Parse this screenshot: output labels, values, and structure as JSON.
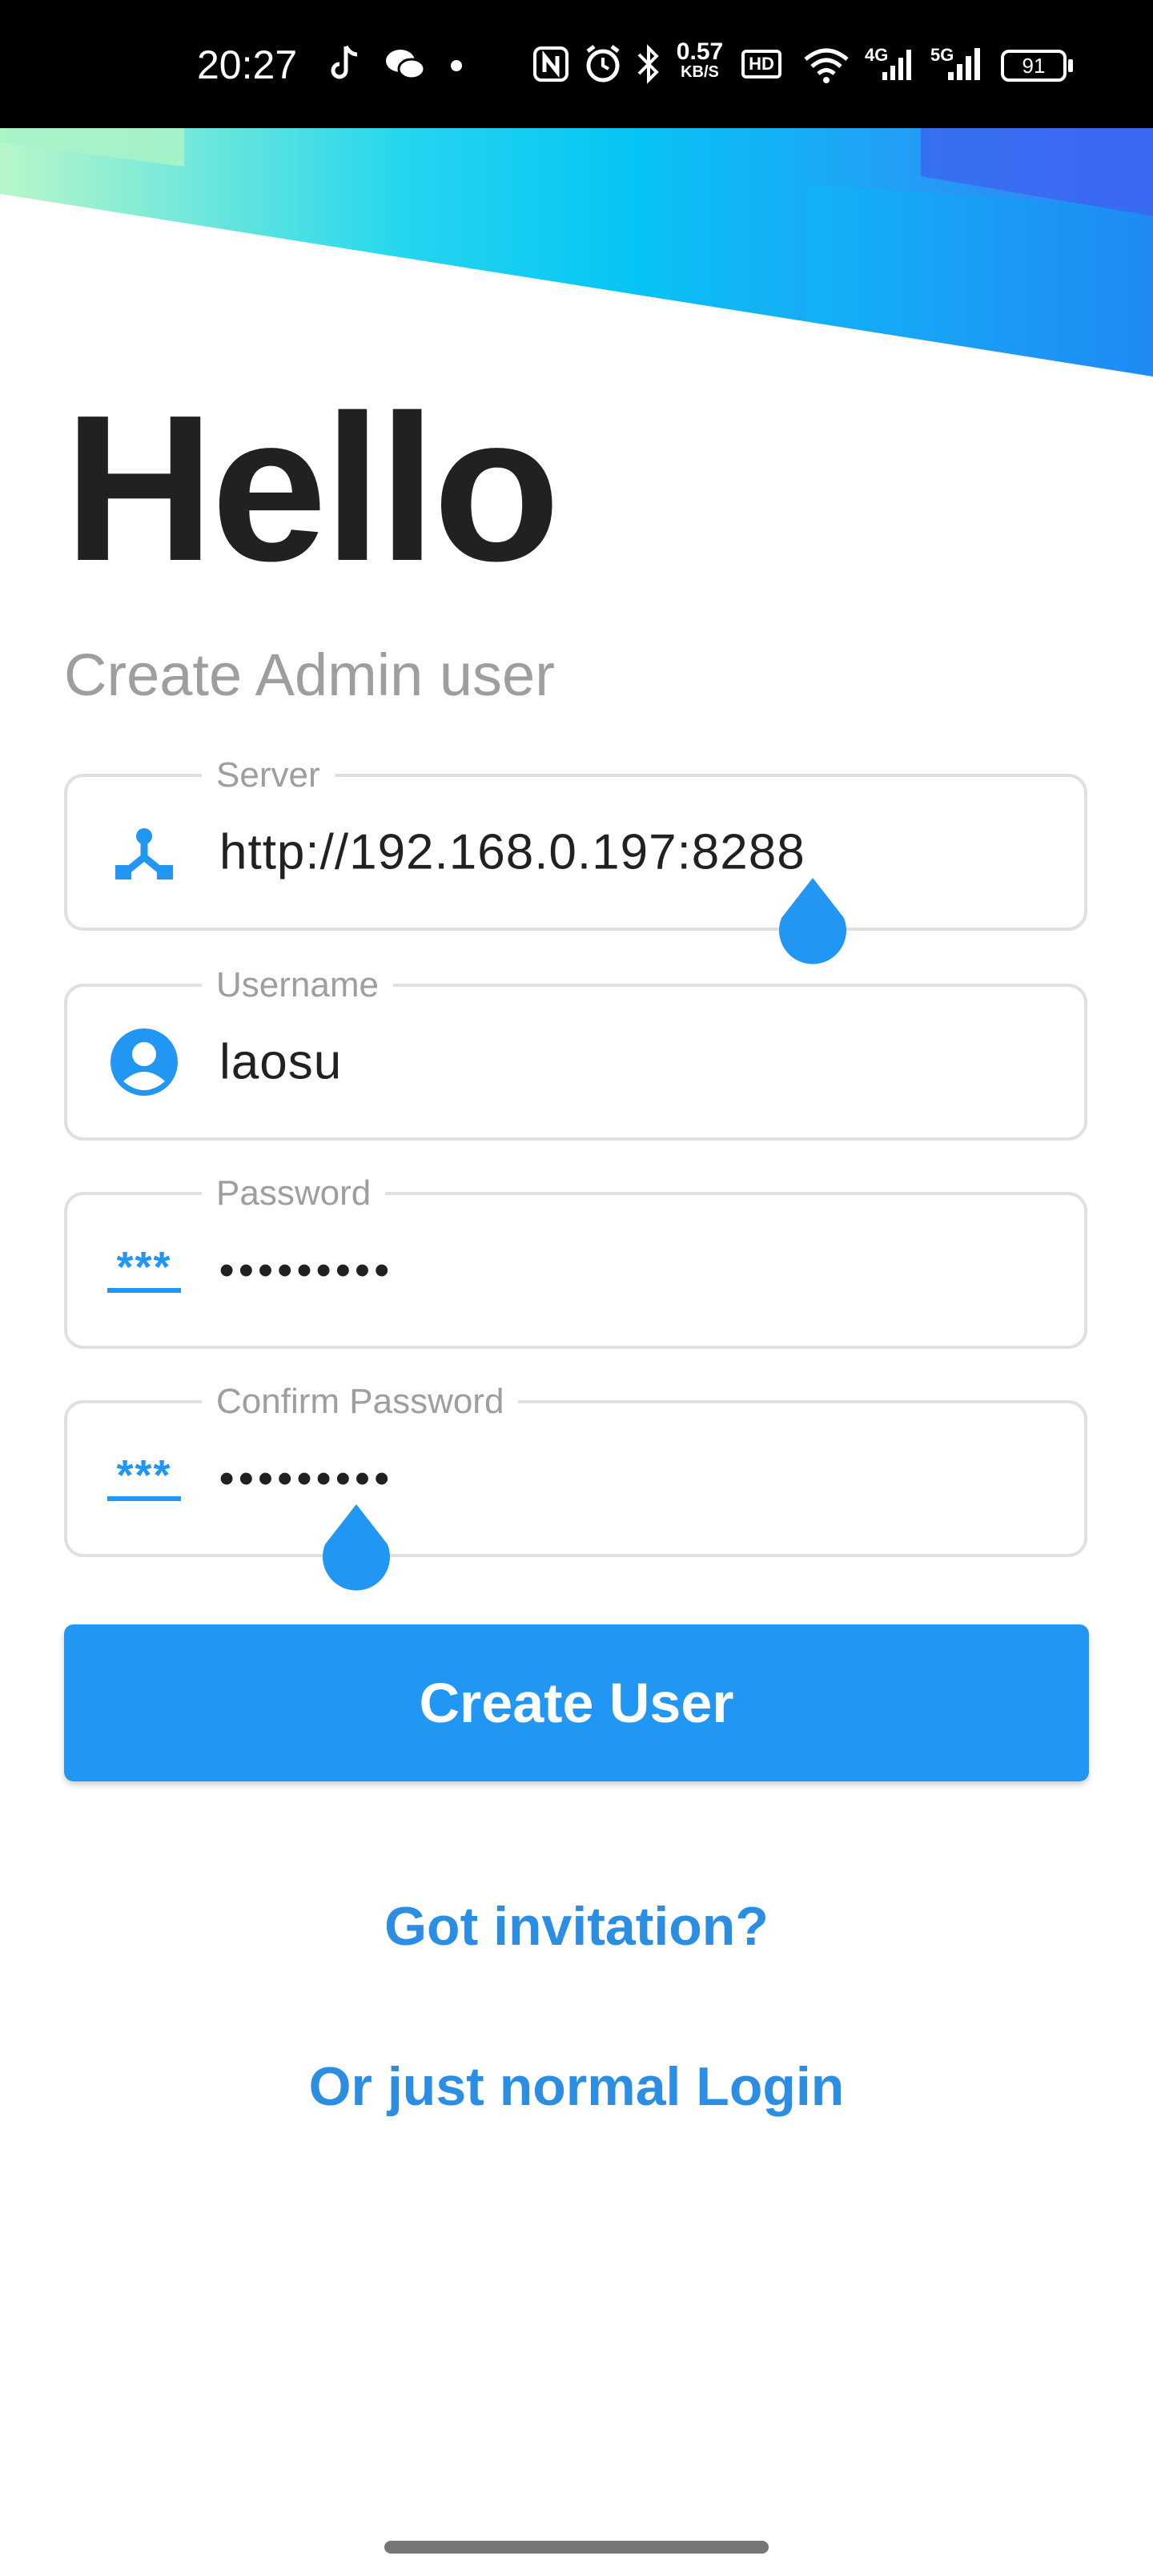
{
  "status_bar": {
    "time": "20:27",
    "network_speed_value": "0.57",
    "network_speed_unit": "KB/S",
    "hd_label": "HD",
    "signal_1": "4G",
    "signal_2": "5G",
    "battery": "91",
    "icons": [
      "tiktok-icon",
      "wechat-icon",
      "dot-icon",
      "nfc-icon",
      "alarm-icon",
      "bluetooth-icon",
      "hd-icon",
      "wifi-icon",
      "signal-icon",
      "battery-icon"
    ]
  },
  "header": {
    "title": "Hello",
    "subtitle": "Create Admin user"
  },
  "form": {
    "server": {
      "label": "Server",
      "value": "http://192.168.0.197:8288",
      "icon": "server-network-icon"
    },
    "username": {
      "label": "Username",
      "value": "laosu",
      "icon": "account-circle-icon"
    },
    "password": {
      "label": "Password",
      "value": "•••••••••",
      "icon": "password-icon",
      "icon_text": "***"
    },
    "confirm_password": {
      "label": "Confirm Password",
      "value": "•••••••••",
      "icon": "password-icon",
      "icon_text": "***"
    }
  },
  "actions": {
    "create_user": "Create User",
    "got_invitation": "Got invitation?",
    "normal_login": "Or just normal Login"
  },
  "colors": {
    "accent": "#2196f3",
    "link": "#2b8ee3",
    "title": "#212121",
    "muted": "#9e9e9e"
  }
}
